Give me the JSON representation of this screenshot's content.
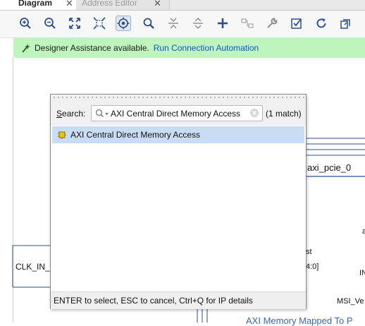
{
  "tabs": [
    {
      "label": "Diagram",
      "active": true,
      "close": "✕"
    },
    {
      "label": "Address Editor",
      "active": false,
      "close": "✕"
    }
  ],
  "toolbar": {
    "icons": [
      "zoom-in-icon",
      "zoom-out-icon",
      "zoom-fit-icon",
      "fit-selection-icon",
      "autoconnect-target-icon",
      "search-icon",
      "collapse-icon",
      "expand-icon",
      "add-ip-icon",
      "make-connection-icon",
      "wrench-icon",
      "validate-icon",
      "refresh-icon",
      "optimize-routing-icon"
    ],
    "active_icon": "autoconnect-target-icon"
  },
  "banner": {
    "text": "Designer Assistance available.",
    "link": "Run Connection Automation",
    "color": "#bdf5bd"
  },
  "diagram": {
    "clk_label": "CLK_IN_",
    "pcie_label": "axi_pcie_0",
    "pin_a": "a",
    "pin_st": "st",
    "pin_40": "4:0]",
    "pin_in": "IN",
    "pin_msi": "MSI_Ve",
    "bottom_label": "AXI Memory Mapped To P"
  },
  "popup": {
    "search_label_prefix": "",
    "search_label_u": "S",
    "search_label_rest": "earch:",
    "search_value": "AXI Central Direct Memory Access",
    "match_count": "(1 match)",
    "results": [
      {
        "label": "AXI Central Direct Memory Access",
        "selected": true
      }
    ],
    "footer_hint": "ENTER to select, ESC to cancel, Ctrl+Q for IP details"
  },
  "colors": {
    "accent_blue": "#1155cc",
    "selection": "#c8dcf5",
    "icon_blue": "#2b4f8f"
  }
}
